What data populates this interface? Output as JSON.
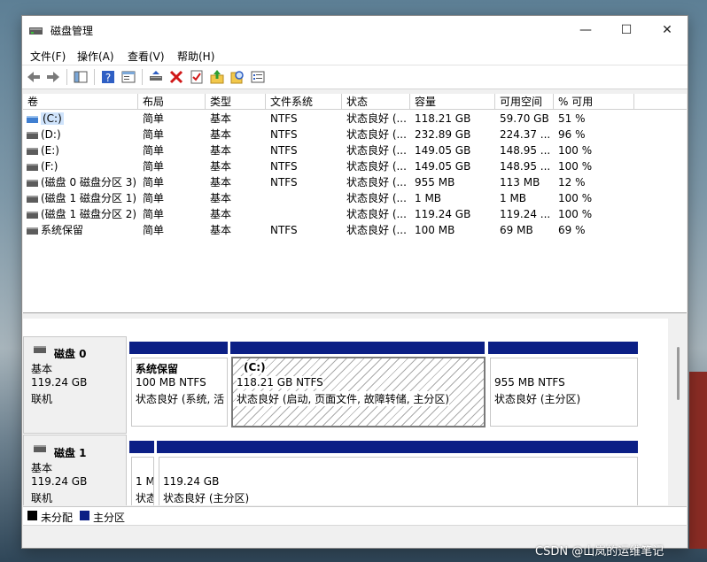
{
  "window": {
    "title": "磁盘管理",
    "minimize": "—",
    "maximize": "☐",
    "close": "✕"
  },
  "menu": [
    "文件(F)",
    "操作(A)",
    "查看(V)",
    "帮助(H)"
  ],
  "toolbar": {
    "icons": [
      "back-arrow-icon",
      "forward-arrow-icon",
      "console-tree-icon",
      "help-icon",
      "properties-icon",
      "connect-drive-icon",
      "delete-icon",
      "checklist-icon",
      "folder-up-icon",
      "search-icon",
      "details-icon"
    ]
  },
  "volume_table": {
    "columns": [
      "卷",
      "布局",
      "类型",
      "文件系统",
      "状态",
      "容量",
      "可用空间",
      "% 可用"
    ],
    "rows": [
      [
        "(C:)",
        "简单",
        "基本",
        "NTFS",
        "状态良好 (...",
        "118.21 GB",
        "59.70 GB",
        "51 %"
      ],
      [
        "(D:)",
        "简单",
        "基本",
        "NTFS",
        "状态良好 (...",
        "232.89 GB",
        "224.37 ...",
        "96 %"
      ],
      [
        "(E:)",
        "简单",
        "基本",
        "NTFS",
        "状态良好 (...",
        "149.05 GB",
        "148.95 ...",
        "100 %"
      ],
      [
        "(F:)",
        "简单",
        "基本",
        "NTFS",
        "状态良好 (...",
        "149.05 GB",
        "148.95 ...",
        "100 %"
      ],
      [
        "(磁盘 0 磁盘分区 3)",
        "简单",
        "基本",
        "NTFS",
        "状态良好 (...",
        "955 MB",
        "113 MB",
        "12 %"
      ],
      [
        "(磁盘 1 磁盘分区 1)",
        "简单",
        "基本",
        "",
        "状态良好 (...",
        "1 MB",
        "1 MB",
        "100 %"
      ],
      [
        "(磁盘 1 磁盘分区 2)",
        "简单",
        "基本",
        "",
        "状态良好 (...",
        "119.24 GB",
        "119.24 ...",
        "100 %"
      ],
      [
        "系统保留",
        "简单",
        "基本",
        "NTFS",
        "状态良好 (...",
        "100 MB",
        "69 MB",
        "69 %"
      ]
    ]
  },
  "disks": [
    {
      "name": "磁盘 0",
      "type": "基本",
      "size": "119.24 GB",
      "state": "联机",
      "partitions": [
        {
          "title": "系统保留",
          "size": "100 MB NTFS",
          "status": "状态良好 (系统, 活"
        },
        {
          "title": "(C:)",
          "size": "118.21 GB NTFS",
          "status": "状态良好 (启动, 页面文件, 故障转储, 主分区)"
        },
        {
          "title": "",
          "size": "955 MB NTFS",
          "status": "状态良好 (主分区)"
        }
      ]
    },
    {
      "name": "磁盘 1",
      "type": "基本",
      "size": "119.24 GB",
      "state": "联机",
      "partitions": [
        {
          "title": "",
          "size": "1 M",
          "status": "状态"
        },
        {
          "title": "",
          "size": "119.24 GB",
          "status": "状态良好 (主分区)"
        }
      ]
    }
  ],
  "legend": [
    {
      "label": "未分配",
      "color": "#000000"
    },
    {
      "label": "主分区",
      "color": "#0b1f85"
    }
  ],
  "watermark": "CSDN @山岚的运维笔记"
}
